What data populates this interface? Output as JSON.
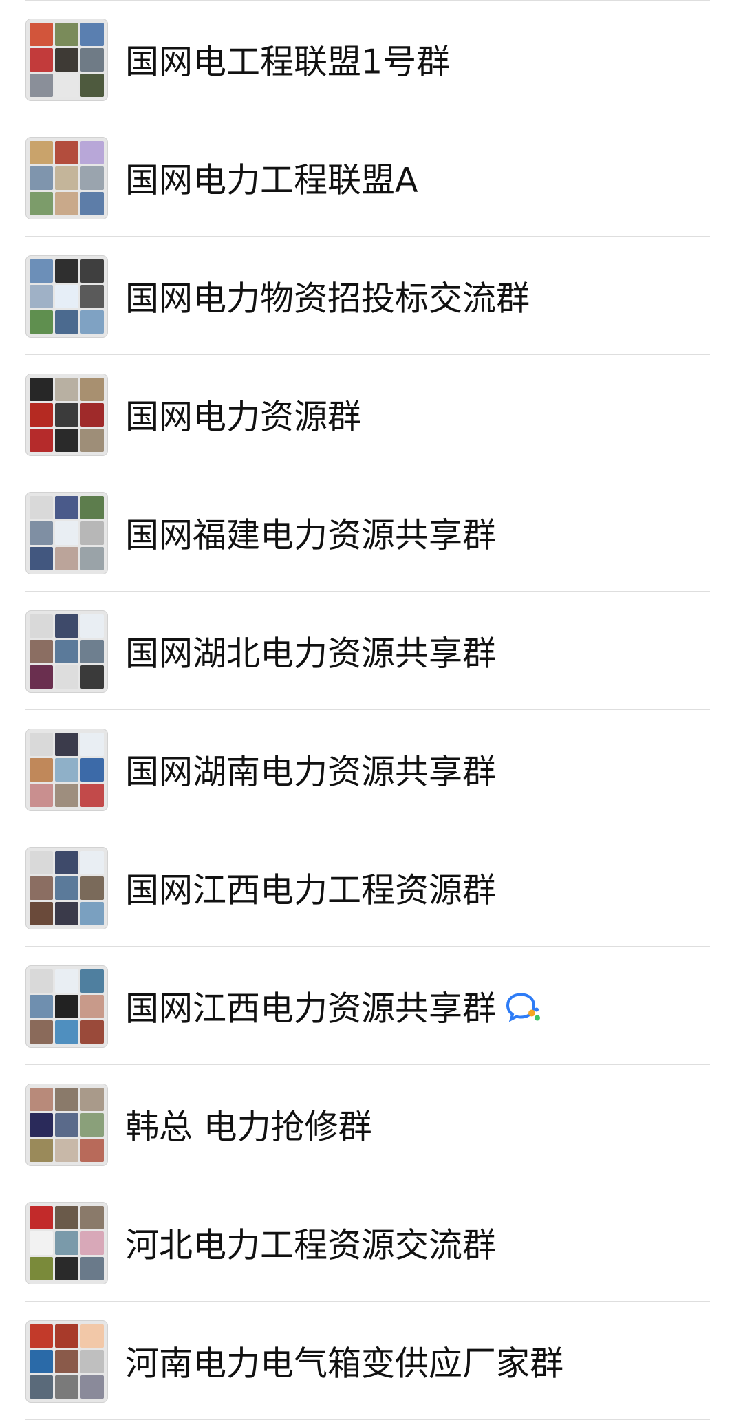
{
  "groups": [
    {
      "name": "国网电工程联盟1号群",
      "cells": [
        "#d2553b",
        "#7a8b5a",
        "#5a7fb0",
        "#c23b3b",
        "#3e3a35",
        "#6f7b86",
        "#8a8f99",
        "#e7e7e7",
        "#4e5a3e"
      ]
    },
    {
      "name": "国网电力工程联盟A",
      "cells": [
        "#c9a36b",
        "#b34d3d",
        "#b8a7d8",
        "#7f95ad",
        "#c4b59a",
        "#9aa4ae",
        "#7c9c6a",
        "#c9a98a",
        "#5d7da8"
      ]
    },
    {
      "name": "国网电力物资招投标交流群",
      "cells": [
        "#6c8fb8",
        "#2f2f2f",
        "#3f3f3f",
        "#9fb1c6",
        "#e6eef7",
        "#5a5a5a",
        "#5f8f4f",
        "#4b6a8f",
        "#7fa2c3"
      ]
    },
    {
      "name": "国网电力资源群",
      "cells": [
        "#272727",
        "#b8b0a2",
        "#a89070",
        "#b52a22",
        "#3b3b3b",
        "#9f2a2a",
        "#b52b2b",
        "#2a2a2a",
        "#9e8e78"
      ]
    },
    {
      "name": "国网福建电力资源共享群",
      "cells": [
        "#d9d9d9",
        "#4a5a8a",
        "#5d7d4d",
        "#7f8fa3",
        "#e9eef3",
        "#b7b7b7",
        "#42577f",
        "#bba49a",
        "#9aa3a8"
      ]
    },
    {
      "name": "国网湖北电力资源共享群",
      "cells": [
        "#d9d9d9",
        "#3e4a6a",
        "#e9eef3",
        "#8b6e62",
        "#5b7a9a",
        "#6e7f8f",
        "#6a2f4f",
        "#dddddd",
        "#3a3a3a"
      ]
    },
    {
      "name": "国网湖南电力资源共享群",
      "cells": [
        "#d9d9d9",
        "#3b3b4b",
        "#e9eef3",
        "#c0885a",
        "#8fb0c8",
        "#3c6aa8",
        "#c98f8f",
        "#9e8e7e",
        "#c24a4a"
      ]
    },
    {
      "name": "国网江西电力工程资源群",
      "cells": [
        "#d9d9d9",
        "#3e4a6a",
        "#e9eef3",
        "#8b6e62",
        "#5b7a9a",
        "#7a6a5a",
        "#6a4a3a",
        "#3a3a4a",
        "#7aa0c0"
      ]
    },
    {
      "name": "国网江西电力资源共享群",
      "cells": [
        "#d9d9d9",
        "#e9eef3",
        "#4f7f9f",
        "#6f8faf",
        "#222222",
        "#c89a8a",
        "#8a6a5a",
        "#4f8fbf",
        "#9a4a3a"
      ]
    },
    {
      "name": "韩总 电力抢修群",
      "cells": [
        "#b88a7a",
        "#8a7a6a",
        "#a99a8a",
        "#2a2a5a",
        "#5a6a8a",
        "#8aa07a",
        "#9a8a5a",
        "#c8b8a8",
        "#b86a5a"
      ]
    },
    {
      "name": "河北电力工程资源交流群",
      "cells": [
        "#c22a2a",
        "#6a5a4a",
        "#8a7a6a",
        "#f2f2f2",
        "#7a9aaa",
        "#d8a8b8",
        "#7a8a3a",
        "#2a2a2a",
        "#6a7a8a"
      ]
    },
    {
      "name": "河南电力电气箱变供应厂家群",
      "cells": [
        "#c23a2a",
        "#a83a2a",
        "#f2c8a8",
        "#2a6aa8",
        "#8a5a4a",
        "#bfbfbf",
        "#5a6a7a",
        "#7a7a7a",
        "#8a8a9a"
      ]
    }
  ],
  "badge_icon": "wecom-chat-icon",
  "badge_row_index": 8,
  "colors": {
    "divider": "#dedede",
    "text": "#111111",
    "wecom_blue": "#2e7cf6",
    "wecom_orange": "#f5a623",
    "wecom_green": "#3cc463"
  }
}
